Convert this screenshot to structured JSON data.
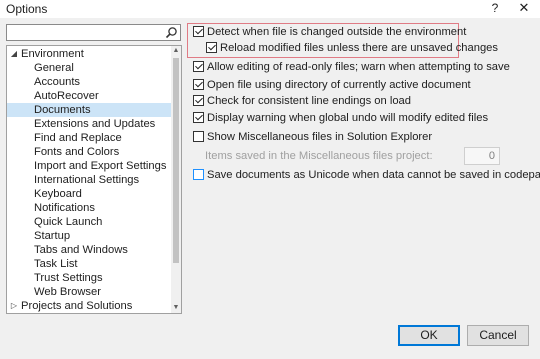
{
  "window": {
    "title": "Options",
    "help_label": "?",
    "close_label": "✕"
  },
  "search": {
    "value": "",
    "placeholder": ""
  },
  "tree": {
    "items": [
      {
        "label": "Environment",
        "level": 0,
        "expander": "◢",
        "selected": false
      },
      {
        "label": "General",
        "level": 1,
        "selected": false
      },
      {
        "label": "Accounts",
        "level": 1,
        "selected": false
      },
      {
        "label": "AutoRecover",
        "level": 1,
        "selected": false
      },
      {
        "label": "Documents",
        "level": 1,
        "selected": true
      },
      {
        "label": "Extensions and Updates",
        "level": 1,
        "selected": false
      },
      {
        "label": "Find and Replace",
        "level": 1,
        "selected": false
      },
      {
        "label": "Fonts and Colors",
        "level": 1,
        "selected": false
      },
      {
        "label": "Import and Export Settings",
        "level": 1,
        "selected": false
      },
      {
        "label": "International Settings",
        "level": 1,
        "selected": false
      },
      {
        "label": "Keyboard",
        "level": 1,
        "selected": false
      },
      {
        "label": "Notifications",
        "level": 1,
        "selected": false
      },
      {
        "label": "Quick Launch",
        "level": 1,
        "selected": false
      },
      {
        "label": "Startup",
        "level": 1,
        "selected": false
      },
      {
        "label": "Tabs and Windows",
        "level": 1,
        "selected": false
      },
      {
        "label": "Task List",
        "level": 1,
        "selected": false
      },
      {
        "label": "Trust Settings",
        "level": 1,
        "selected": false
      },
      {
        "label": "Web Browser",
        "level": 1,
        "selected": false
      },
      {
        "label": "Projects and Solutions",
        "level": 0,
        "expander": "▷",
        "selected": false
      }
    ]
  },
  "options": {
    "detect_changes": {
      "label": "Detect when file is changed outside the environment",
      "checked": true
    },
    "reload_modified": {
      "label": "Reload modified files unless there are unsaved changes",
      "checked": true
    },
    "allow_readonly_edit": {
      "label": "Allow editing of read-only files; warn when attempting to save",
      "checked": true
    },
    "open_file_dir": {
      "label": "Open file using directory of currently active document",
      "checked": true
    },
    "check_line_endings": {
      "label": "Check for consistent line endings on load",
      "checked": true
    },
    "global_undo_warning": {
      "label": "Display warning when global undo will modify edited files",
      "checked": true
    },
    "show_misc_files": {
      "label": "Show Miscellaneous files in Solution Explorer",
      "checked": false
    },
    "misc_items_label": "Items saved in the Miscellaneous files project:",
    "misc_items_value": "0",
    "save_unicode": {
      "label": "Save documents as Unicode when data cannot be saved in codepage",
      "checked": false
    }
  },
  "buttons": {
    "ok_label": "OK",
    "cancel_label": "Cancel"
  },
  "colors": {
    "selection": "#cce4f7",
    "highlight_border": "#e07b85",
    "default_button_border": "#0078d7"
  }
}
